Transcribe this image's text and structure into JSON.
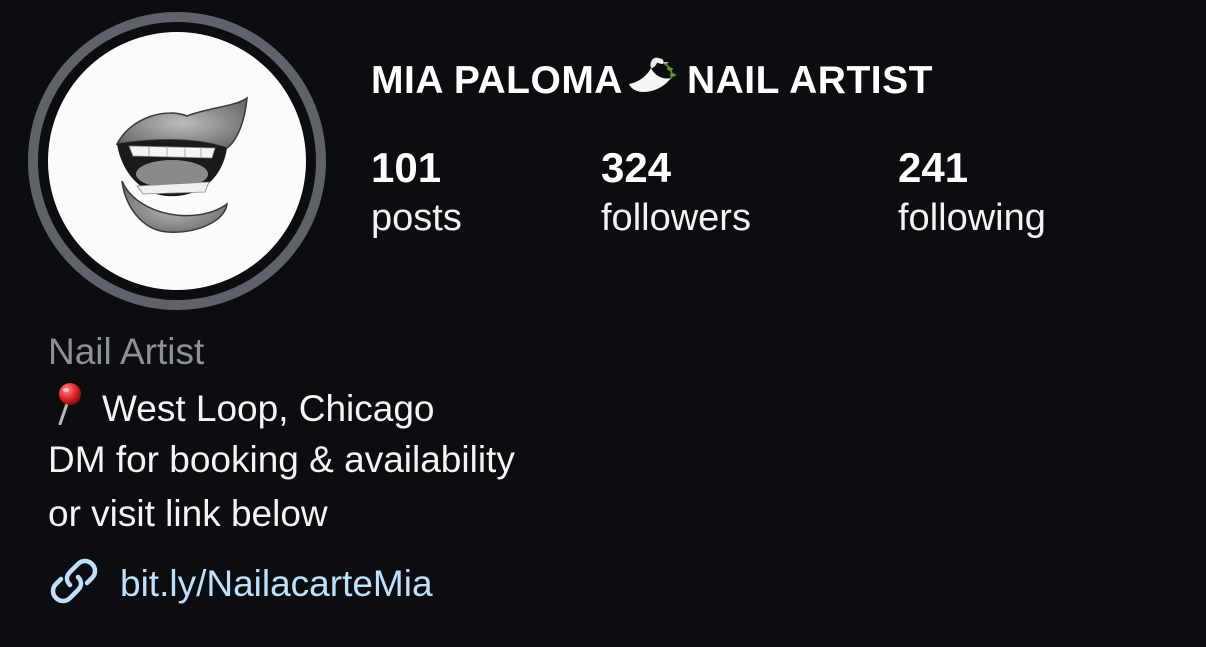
{
  "profile": {
    "name_part1": "MIA PALOMA",
    "name_part2": "NAIL ARTIST",
    "name_emoji": "dove-icon",
    "avatar": "mouth-photo",
    "stats": {
      "posts": {
        "count": "101",
        "label": "posts"
      },
      "followers": {
        "count": "324",
        "label": "followers"
      },
      "following": {
        "count": "241",
        "label": "following"
      }
    },
    "category": "Nail Artist",
    "bio": {
      "location_icon": "pin-icon",
      "location": "West Loop, Chicago",
      "line2": "DM for booking & availability",
      "line3": "or visit link below"
    },
    "link": {
      "icon": "link-icon",
      "text": "bit.ly/NailacarteMia"
    }
  },
  "colors": {
    "background": "#0c0d10",
    "ring": "#5f6268",
    "category_text": "#8e9097",
    "link_text": "#bfe0fb"
  }
}
